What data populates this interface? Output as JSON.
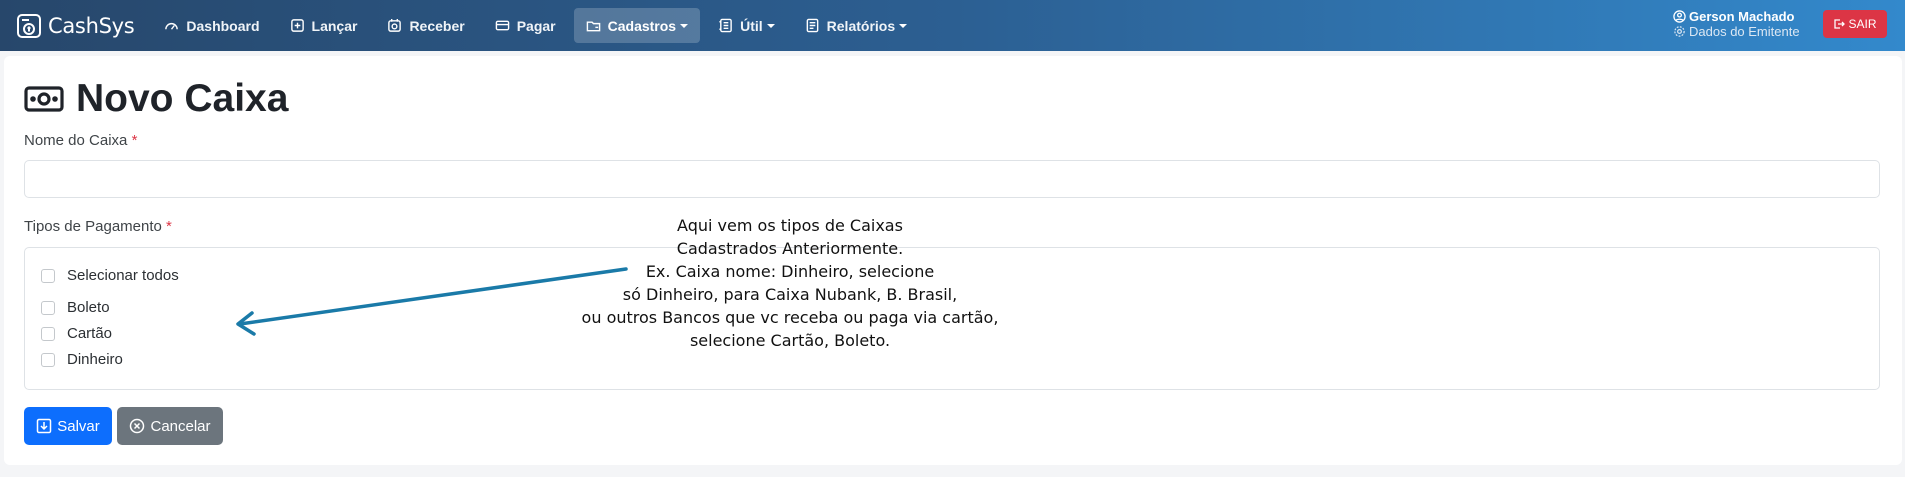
{
  "brand": {
    "name": "CashSys",
    "icon": "cash-register-icon"
  },
  "nav": [
    {
      "label": "Dashboard",
      "icon": "dashboard-icon",
      "dropdown": false,
      "active": false
    },
    {
      "label": "Lançar",
      "icon": "plus-square-icon",
      "dropdown": false,
      "active": false
    },
    {
      "label": "Receber",
      "icon": "receive-icon",
      "dropdown": false,
      "active": false
    },
    {
      "label": "Pagar",
      "icon": "credit-card-icon",
      "dropdown": false,
      "active": false
    },
    {
      "label": "Cadastros",
      "icon": "folder-icon",
      "dropdown": true,
      "active": true
    },
    {
      "label": "Útil",
      "icon": "notebook-icon",
      "dropdown": true,
      "active": false
    },
    {
      "label": "Relatórios",
      "icon": "report-icon",
      "dropdown": true,
      "active": false
    }
  ],
  "user": {
    "name": "Gerson Machado",
    "sub": "Dados do Emitente"
  },
  "logout": {
    "label": "SAIR"
  },
  "page": {
    "title": "Novo Caixa",
    "icon": "cash-icon"
  },
  "form": {
    "name_label": "Nome do Caixa",
    "name_value": "",
    "payment_label": "Tipos de Pagamento",
    "required_mark": "*",
    "select_all": "Selecionar todos",
    "options": [
      "Boleto",
      "Cartão",
      "Dinheiro"
    ]
  },
  "annotation": {
    "lines": [
      "Aqui vem os tipos de Caixas",
      "Cadastrados Anteriormente.",
      "Ex. Caixa nome: Dinheiro, selecione",
      "só Dinheiro, para Caixa Nubank, B. Brasil,",
      "ou outros Bancos que vc receba ou paga via cartão,",
      "selecione Cartão, Boleto."
    ],
    "arrow_color": "#1a7aa8"
  },
  "buttons": {
    "save": "Salvar",
    "cancel": "Cancelar"
  },
  "colors": {
    "primary": "#0d6efd",
    "danger": "#dc3545",
    "secondary": "#6c757d"
  }
}
